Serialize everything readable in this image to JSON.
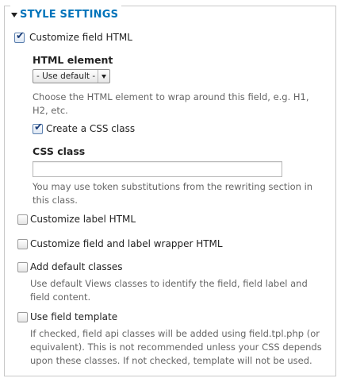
{
  "fieldset": {
    "legend": "STYLE SETTINGS",
    "legend_color": "#0073ba"
  },
  "customize_field_html": {
    "label": "Customize field HTML",
    "checked": true
  },
  "html_element": {
    "heading": "HTML element",
    "selected": "- Use default -",
    "description": "Choose the HTML element to wrap around this field, e.g. H1, H2, etc."
  },
  "create_css_class": {
    "label": "Create a CSS class",
    "checked": true
  },
  "css_class": {
    "heading": "CSS class",
    "value": "",
    "description": "You may use token substitutions from the rewriting section in this class."
  },
  "customize_label_html": {
    "label": "Customize label HTML",
    "checked": false
  },
  "customize_wrapper_html": {
    "label": "Customize field and label wrapper HTML",
    "checked": false
  },
  "add_default_classes": {
    "label": "Add default classes",
    "checked": false,
    "description": "Use default Views classes to identify the field, field label and field content."
  },
  "use_field_template": {
    "label": "Use field template",
    "checked": false,
    "description": "If checked, field api classes will be added using field.tpl.php (or equivalent). This is not recommended unless your CSS depends upon these classes. If not checked, template will not be used."
  },
  "icons": {
    "legend_toggle": "collapse-triangle-icon",
    "select_arrow": "dropdown-arrow-icon",
    "checkmark": "checkmark-icon"
  }
}
